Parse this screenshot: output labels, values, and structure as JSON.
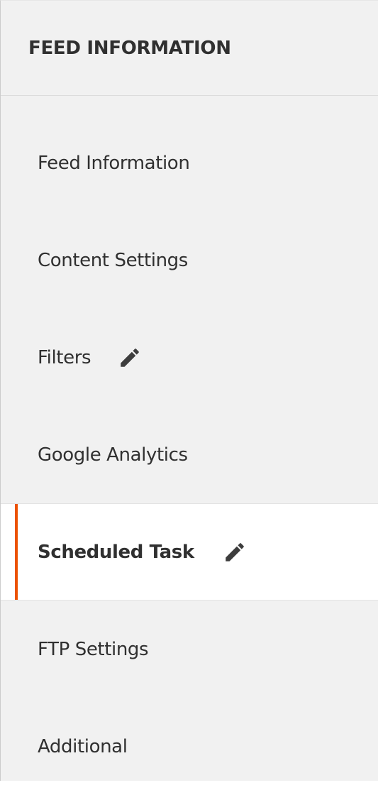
{
  "header": {
    "title": "FEED INFORMATION"
  },
  "nav": {
    "items": [
      {
        "label": "Feed Information",
        "has_edit_icon": false,
        "active": false
      },
      {
        "label": "Content Settings",
        "has_edit_icon": false,
        "active": false
      },
      {
        "label": "Filters",
        "has_edit_icon": true,
        "icon": "pencil-icon",
        "active": false
      },
      {
        "label": "Google Analytics",
        "has_edit_icon": false,
        "active": false
      },
      {
        "label": "Scheduled Task",
        "has_edit_icon": true,
        "icon": "pencil-icon",
        "active": true
      },
      {
        "label": "FTP Settings",
        "has_edit_icon": false,
        "active": false
      },
      {
        "label": "Additional",
        "has_edit_icon": false,
        "active": false
      }
    ]
  },
  "colors": {
    "panel_background": "#f1f1f1",
    "active_background": "#ffffff",
    "active_indicator": "#eb5202",
    "text": "#303030"
  }
}
